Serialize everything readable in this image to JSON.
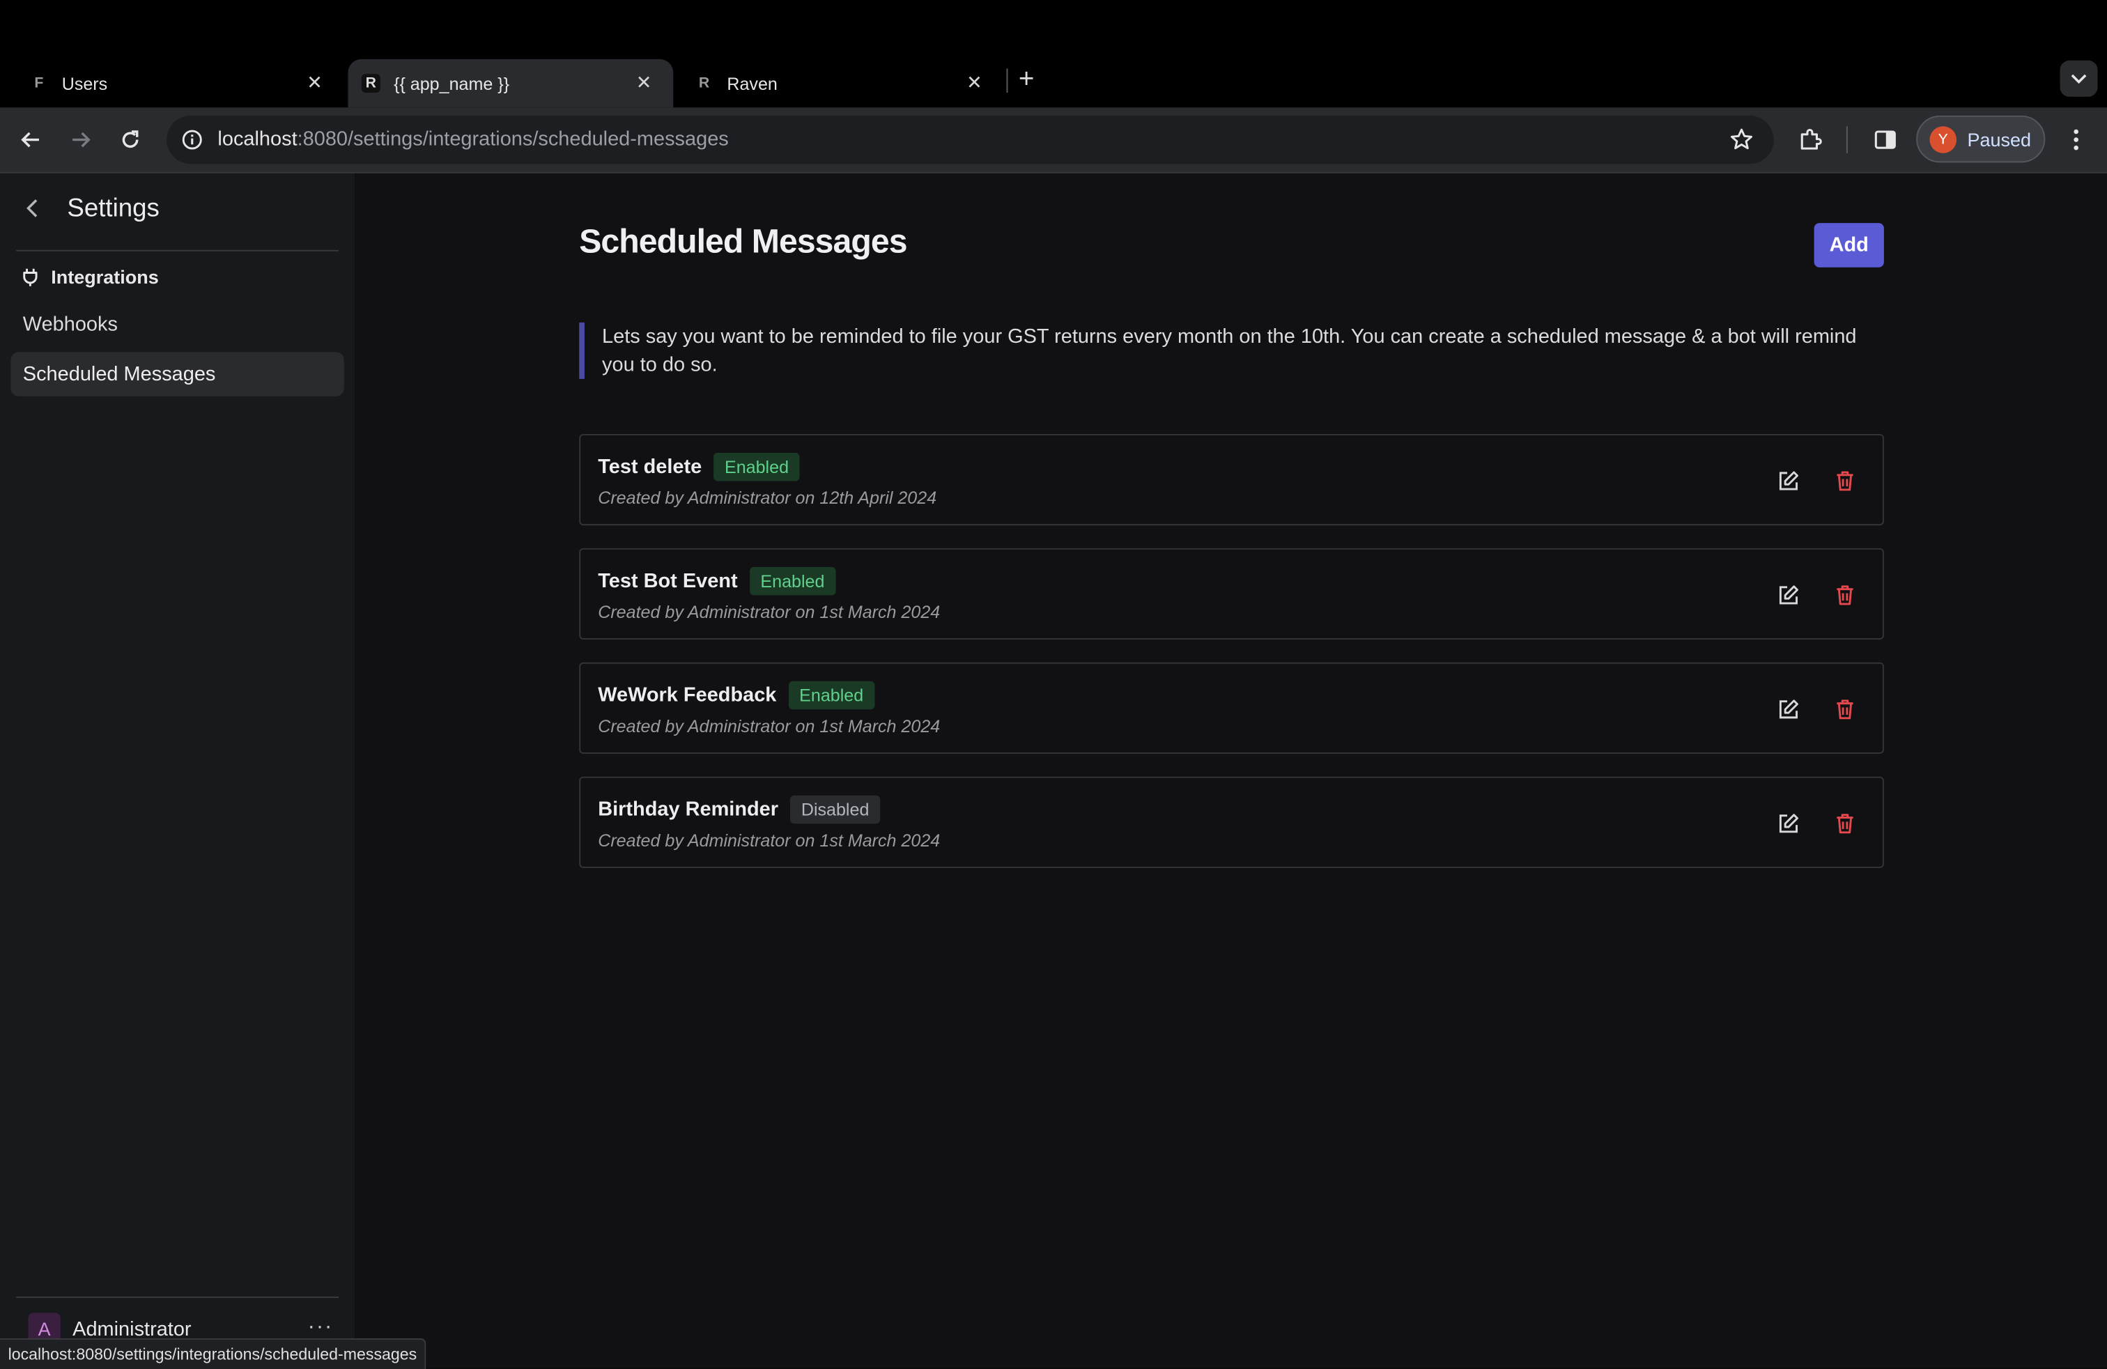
{
  "browser": {
    "tabs": [
      {
        "title": "Users",
        "favicon": "frappe-icon",
        "active": false
      },
      {
        "title": "{{ app_name }}",
        "favicon": "raven-icon",
        "active": true
      },
      {
        "title": "Raven",
        "favicon": "raven-icon",
        "active": false
      }
    ],
    "url_host": "localhost",
    "url_path": ":8080/settings/integrations/scheduled-messages",
    "profile_initial": "Y",
    "profile_label": "Paused",
    "status_url": "localhost:8080/settings/integrations/scheduled-messages"
  },
  "sidebar": {
    "title": "Settings",
    "group_label": "Integrations",
    "items": [
      {
        "label": "Webhooks",
        "selected": false
      },
      {
        "label": "Scheduled Messages",
        "selected": true
      }
    ],
    "user_initial": "A",
    "user_name": "Administrator",
    "more": "···"
  },
  "main": {
    "title": "Scheduled Messages",
    "add_label": "Add",
    "description": "Lets say you want to be reminded to file your GST returns every month on the 10th. You can create a scheduled message & a bot will remind you to do so.",
    "messages": [
      {
        "name": "Test delete",
        "status": "Enabled",
        "meta": "Created by Administrator on 12th April 2024"
      },
      {
        "name": "Test Bot Event",
        "status": "Enabled",
        "meta": "Created by Administrator on 1st March 2024"
      },
      {
        "name": "WeWork Feedback",
        "status": "Enabled",
        "meta": "Created by Administrator on 1st March 2024"
      },
      {
        "name": "Birthday Reminder",
        "status": "Disabled",
        "meta": "Created by Administrator on 1st March 2024"
      }
    ]
  },
  "colors": {
    "accent": "#5b5bd6",
    "enabled_text": "#5fd18a",
    "delete_icon": "#e5484d"
  }
}
